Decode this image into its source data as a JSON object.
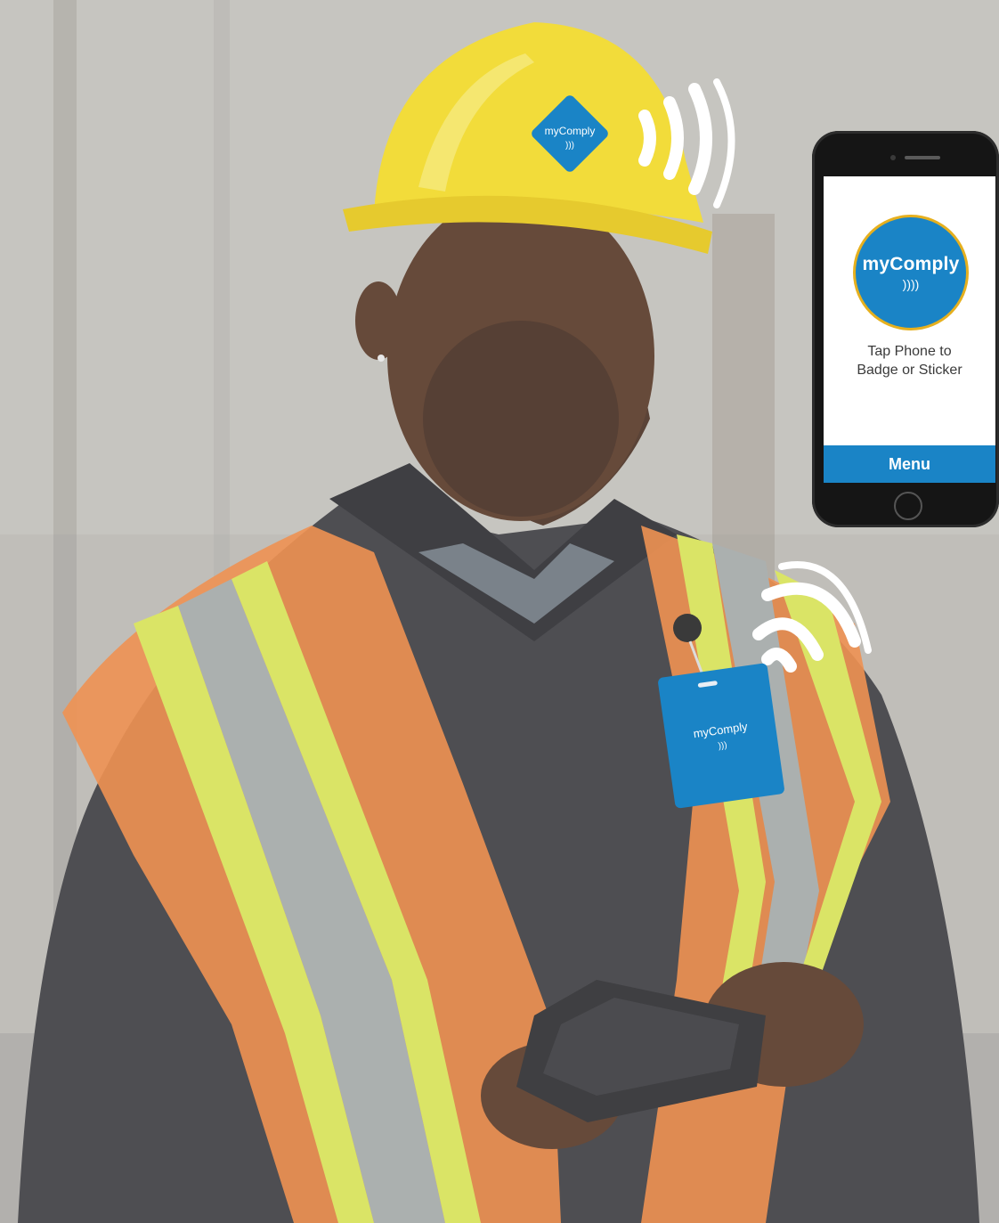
{
  "phone": {
    "logo_text": "myComply",
    "nfc_glyph": "))))",
    "instruction_line1": "Tap Phone to",
    "instruction_line2": "Badge or Sticker",
    "menu_label": "Menu"
  },
  "helmet_sticker": {
    "logo_text": "myComply",
    "nfc_glyph": ")))"
  },
  "vest_badge": {
    "logo_text": "myComply",
    "nfc_glyph": ")))"
  },
  "colors": {
    "brand_blue": "#1a84c6",
    "accent_gold": "#e6b01e",
    "helmet_yellow": "#f1da2a",
    "vest_orange": "#ee8a45",
    "vest_yellow": "#d7e25a",
    "background": "#b9b7b2"
  }
}
